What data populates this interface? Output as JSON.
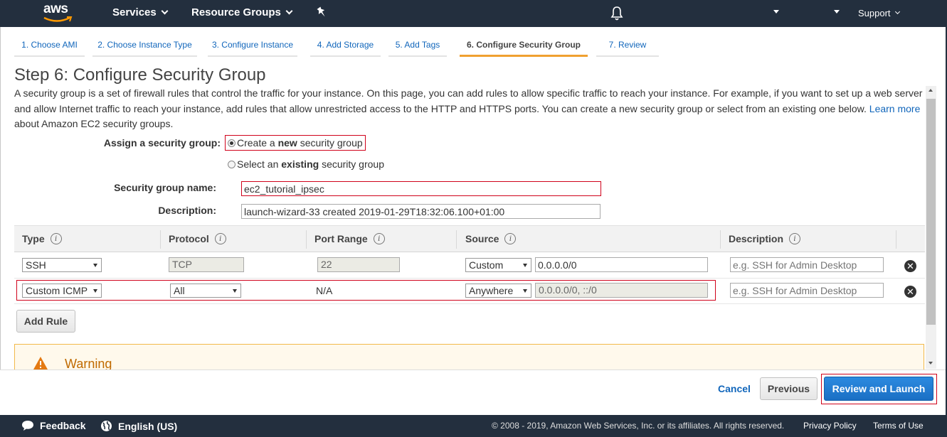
{
  "topnav": {
    "logo": "aws",
    "services": "Services",
    "resource_groups": "Resource Groups",
    "support": "Support",
    "icons": [
      "pin-icon",
      "bell-icon"
    ]
  },
  "wizard": {
    "tabs": [
      {
        "label": "1. Choose AMI"
      },
      {
        "label": "2. Choose Instance Type"
      },
      {
        "label": "3. Configure Instance"
      },
      {
        "label": "4. Add Storage"
      },
      {
        "label": "5. Add Tags"
      },
      {
        "label": "6. Configure Security Group",
        "active": true
      },
      {
        "label": "7. Review"
      }
    ]
  },
  "page": {
    "title": "Step 6: Configure Security Group",
    "description": "A security group is a set of firewall rules that control the traffic for your instance. On this page, you can add rules to allow specific traffic to reach your instance. For example, if you want to set up a web server and allow Internet traffic to reach your instance, add rules that allow unrestricted access to the HTTP and HTTPS ports. You can create a new security group or select from an existing one below.",
    "learn_more": "Learn more",
    "description_tail": "about Amazon EC2 security groups."
  },
  "form": {
    "assign_label": "Assign a security group:",
    "option_new_pre": "Create a ",
    "option_new_bold": "new",
    "option_new_post": " security group",
    "option_existing_pre": "Select an ",
    "option_existing_bold": "existing",
    "option_existing_post": " security group",
    "selected_option": "new",
    "name_label": "Security group name:",
    "name_value": "ec2_tutorial_ipsec",
    "desc_label": "Description:",
    "desc_value": "launch-wizard-33 created 2019-01-29T18:32:06.100+01:00"
  },
  "table": {
    "headers": [
      "Type",
      "Protocol",
      "Port Range",
      "Source",
      "Description"
    ],
    "info_icon": "i",
    "rows": [
      {
        "type": "SSH",
        "protocol": "TCP",
        "port": "22",
        "source_mode": "Custom",
        "source_value": "0.0.0.0/0",
        "description_placeholder": "e.g. SSH for Admin Desktop"
      },
      {
        "type": "Custom ICMP",
        "protocol": "All",
        "port": "N/A",
        "source_mode": "Anywhere",
        "source_value": "0.0.0.0/0, ::/0",
        "description_placeholder": "e.g. SSH for Admin Desktop"
      }
    ],
    "remove_glyph": "✕"
  },
  "actions": {
    "add_rule": "Add Rule",
    "cancel": "Cancel",
    "previous": "Previous",
    "review_launch": "Review and Launch"
  },
  "warning": {
    "title": "Warning"
  },
  "footer": {
    "feedback": "Feedback",
    "language": "English (US)",
    "copyright": "© 2008 - 2019, Amazon Web Services, Inc. or its affiliates. All rights reserved.",
    "privacy": "Privacy Policy",
    "terms": "Terms of Use"
  },
  "colors": {
    "nav_bg": "#232f3e",
    "link": "#1166bb",
    "active_tab": "#f0a030",
    "primary_button": "#1a6fc4",
    "highlight_outline": "#d0021b",
    "warning_border": "#f2b94b"
  }
}
